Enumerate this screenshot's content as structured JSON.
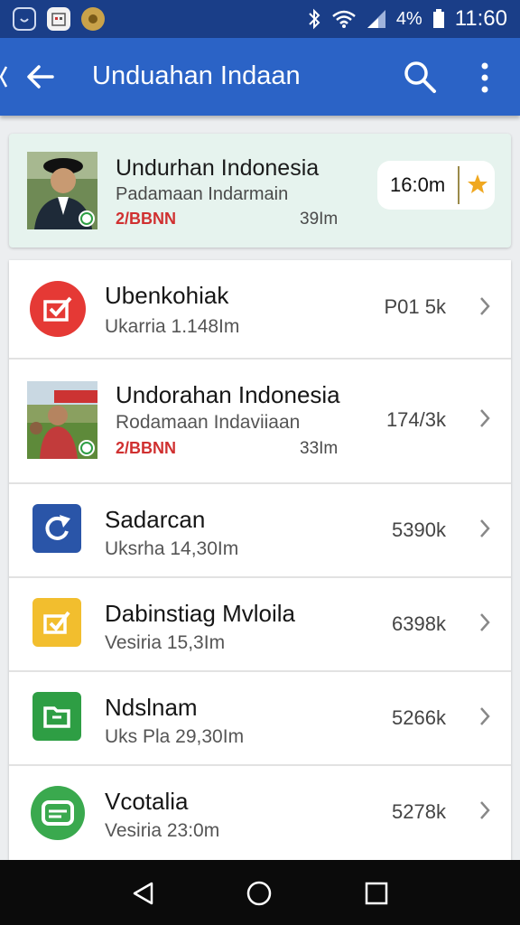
{
  "status_bar": {
    "battery": "4%",
    "time": "11:60",
    "icons": [
      "app-notification-icon",
      "calendar-icon",
      "badge-icon",
      "bluetooth-icon",
      "wifi-icon",
      "signal-icon",
      "battery-icon"
    ]
  },
  "app_bar": {
    "title": "Unduahan Indaan",
    "icons": [
      "back-arrow-icon",
      "search-icon",
      "more-vert-icon"
    ]
  },
  "featured": {
    "title": "Undurhan Indonesia",
    "subtitle": "Padamaan Indarmain",
    "tag": "2/BBNN",
    "size": "39Im",
    "time": "16:0m",
    "star_color": "#f0a820"
  },
  "list": [
    {
      "title": "Ubenkohiak",
      "subtitle": "Ukarria 1.148Im",
      "count": "P01 5k",
      "icon": "red-circle-check-icon",
      "color": "#e53935"
    },
    {
      "title": "Undorahan Indonesia",
      "subtitle": "Rodamaan Indaviiaan",
      "tag": "2/BBNN",
      "size": "33Im",
      "count": "174/3k",
      "icon": "photo-thumbnail"
    },
    {
      "title": "Sadarcan",
      "subtitle": "Uksrha 14,30Im",
      "count": "5390k",
      "icon": "blue-refresh-icon",
      "color": "#2a55a8"
    },
    {
      "title": "Dabinstiag Mvloila",
      "subtitle": "Vesiria 15,3Im",
      "count": "6398k",
      "icon": "yellow-check-icon",
      "color": "#f2be2e"
    },
    {
      "title": "Ndslnam",
      "subtitle": "Uks Pla 29,30Im",
      "count": "5266k",
      "icon": "green-folder-icon",
      "color": "#2e9e44"
    },
    {
      "title": "Vcotalia",
      "subtitle": "Vesiria 23:0m",
      "count": "5278k",
      "icon": "green-chat-icon",
      "color": "#3aa94e"
    }
  ],
  "nav_bar": {
    "icons": [
      "back-triangle-icon",
      "home-circle-icon",
      "recents-square-icon"
    ]
  }
}
